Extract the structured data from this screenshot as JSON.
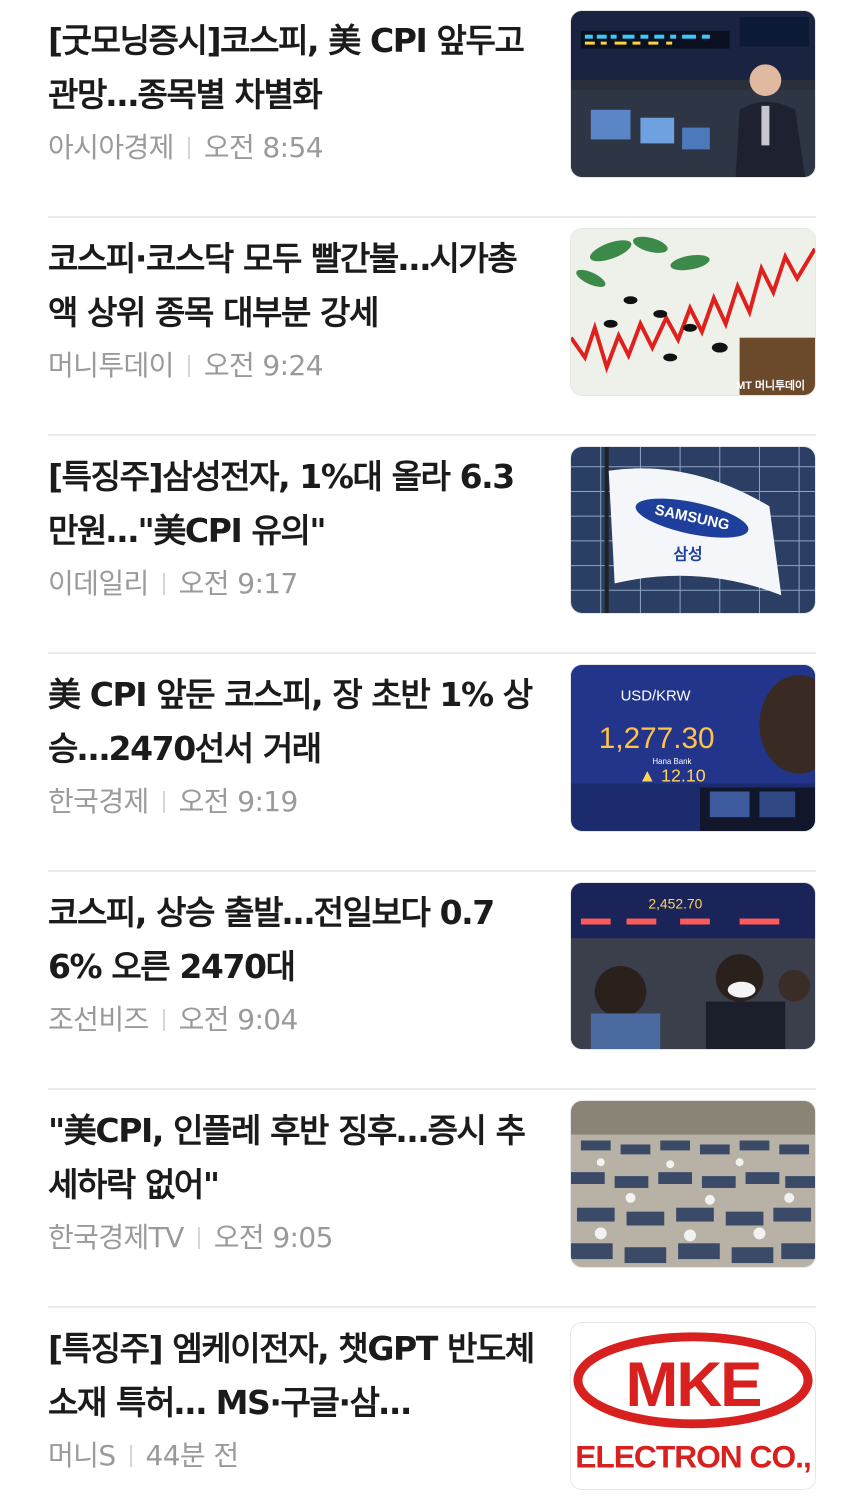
{
  "articles": [
    {
      "headline": "[굿모닝증시]코스피, 美 CPI 앞두고 관망…종목별 차별화",
      "source": "아시아경제",
      "time": "오전 8:54",
      "image_caption": ""
    },
    {
      "headline": "코스피·코스닥 모두 빨간불…시가총액 상위 종목 대부분 강세",
      "source": "머니투데이",
      "time": "오전 9:24",
      "image_caption": "MT 머니투데이"
    },
    {
      "headline": "[특징주]삼성전자, 1%대 올라 6.3만원…\"美CPI 유의\"",
      "source": "이데일리",
      "time": "오전 9:17",
      "image_flag_text": "SAMSUNG",
      "image_flag_subtext": "삼성"
    },
    {
      "headline": "美 CPI 앞둔 코스피, 장 초반 1% 상승…2470선서 거래",
      "source": "한국경제",
      "time": "오전 9:19",
      "image_label": "USD/KRW",
      "image_value": "1,277.30",
      "image_change": "▲ 12.10",
      "image_bank": "Hana Bank"
    },
    {
      "headline": "코스피, 상승 출발…전일보다 0.76% 오른 2470대",
      "source": "조선비즈",
      "time": "오전 9:04",
      "image_value": "2,452.70"
    },
    {
      "headline": "\"美CPI, 인플레 후반 징후…증시 추세하락 없어\"",
      "source": "한국경제TV",
      "time": "오전 9:05"
    },
    {
      "headline": "[특징주] 엠케이전자, 챗GPT 반도체 소재 특허… MS·구글·삼…",
      "source": "머니S",
      "time": "44분 전",
      "image_logo_main": "MKE",
      "image_logo_sub": "ELECTRON CO.,"
    }
  ],
  "colors": {
    "headline": "#1b1b1b",
    "meta": "#9a9a9a",
    "divider": "#ececec"
  }
}
